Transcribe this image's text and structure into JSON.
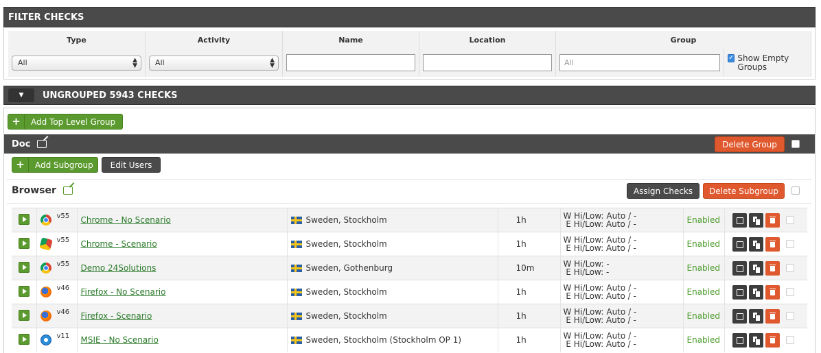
{
  "filter": {
    "title": "FILTER CHECKS",
    "columns": [
      "Type",
      "Activity",
      "Name",
      "Location",
      "Group"
    ],
    "type_value": "All",
    "activity_value": "All",
    "name_value": "",
    "location_value": "",
    "group_placeholder": "All",
    "show_empty_label": "Show Empty Groups",
    "show_empty_checked": true
  },
  "ungrouped": {
    "label": "UNGROUPED 5943 CHECKS"
  },
  "toolbar": {
    "add_top_level_group": "Add Top Level Group"
  },
  "group": {
    "name": "Doc",
    "delete_label": "Delete Group",
    "add_subgroup_label": "Add Subgroup",
    "edit_users_label": "Edit Users"
  },
  "subgroup": {
    "name": "Browser",
    "assign_checks_label": "Assign Checks",
    "delete_label": "Delete Subgroup"
  },
  "checks": [
    {
      "browser_icon": "chrome-icon",
      "version": "v55",
      "name": "Chrome - No Scenario",
      "location": "Sweden, Stockholm",
      "interval": "1h",
      "w_threshold": "W Hi/Low: Auto / -",
      "e_threshold": " E Hi/Low: Auto / -",
      "status": "Enabled"
    },
    {
      "browser_icon": "chrome-scenario-icon",
      "version": "v55",
      "name": "Chrome - Scenario",
      "location": "Sweden, Stockholm",
      "interval": "1h",
      "w_threshold": "W Hi/Low: Auto / -",
      "e_threshold": " E Hi/Low: Auto / -",
      "status": "Enabled"
    },
    {
      "browser_icon": "chrome-icon",
      "version": "v55",
      "name": "Demo 24Solutions",
      "location": "Sweden, Gothenburg",
      "interval": "10m",
      "w_threshold": "W Hi/Low: -",
      "e_threshold": " E Hi/Low: -",
      "status": "Enabled"
    },
    {
      "browser_icon": "firefox-icon",
      "version": "v46",
      "name": "Firefox - No Scenario",
      "location": "Sweden, Stockholm",
      "interval": "1h",
      "w_threshold": "W Hi/Low: Auto / -",
      "e_threshold": " E Hi/Low: Auto / -",
      "status": "Enabled"
    },
    {
      "browser_icon": "firefox-scenario-icon",
      "version": "v46",
      "name": "Firefox - Scenario",
      "location": "Sweden, Stockholm",
      "interval": "1h",
      "w_threshold": "W Hi/Low: Auto / -",
      "e_threshold": " E Hi/Low: Auto / -",
      "status": "Enabled"
    },
    {
      "browser_icon": "ie-icon",
      "version": "v11",
      "name": "MSIE - No Scenario",
      "location": "Sweden, Stockholm (Stockholm OP 1)",
      "interval": "1h",
      "w_threshold": "W Hi/Low: Auto / -",
      "e_threshold": " E Hi/Low: Auto / -",
      "status": "Enabled"
    }
  ],
  "colors": {
    "header_bg": "#4a4a4a",
    "green": "#5b9a2e",
    "orange": "#e0592e",
    "status_green": "#4a9a28"
  }
}
